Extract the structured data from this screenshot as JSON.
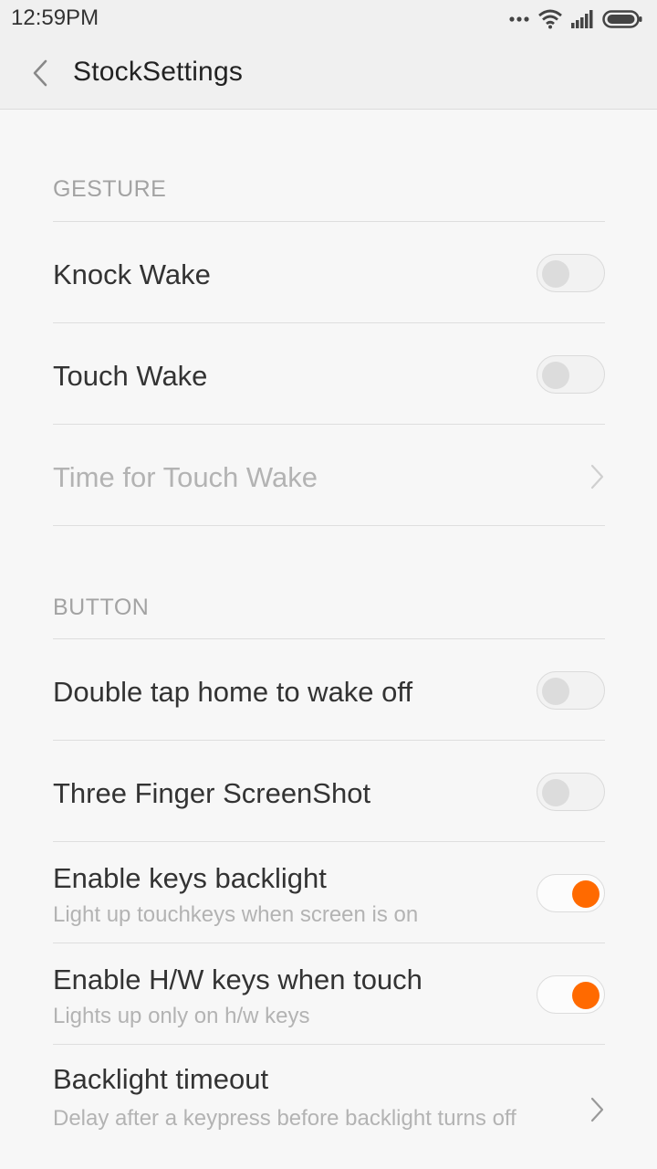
{
  "status": {
    "time": "12:59PM",
    "icons": [
      "more-dots-icon",
      "wifi-icon",
      "signal-icon",
      "battery-icon"
    ]
  },
  "header": {
    "title": "StockSettings",
    "back_icon": "back-chevron-icon"
  },
  "sections": {
    "gesture": {
      "label": "GESTURE",
      "items": [
        {
          "title": "Knock Wake",
          "toggle": false
        },
        {
          "title": "Touch Wake",
          "toggle": false
        },
        {
          "title": "Time for Touch Wake",
          "disabled": true,
          "chevron": true
        }
      ]
    },
    "button": {
      "label": "BUTTON",
      "items": [
        {
          "title": "Double tap home to wake off",
          "toggle": false
        },
        {
          "title": "Three Finger ScreenShot",
          "toggle": false
        },
        {
          "title": "Enable keys backlight",
          "subtitle": "Light up touchkeys when screen is on",
          "toggle": true
        },
        {
          "title": "Enable H/W keys when touch",
          "subtitle": "Lights up only on h/w keys",
          "toggle": true
        },
        {
          "title": "Backlight timeout",
          "subtitle": "Delay after a keypress before backlight turns off",
          "chevron": true
        }
      ]
    }
  },
  "colors": {
    "accent": "#ff6a00",
    "background": "#f7f7f7",
    "header_bg": "#f0f0f0"
  }
}
